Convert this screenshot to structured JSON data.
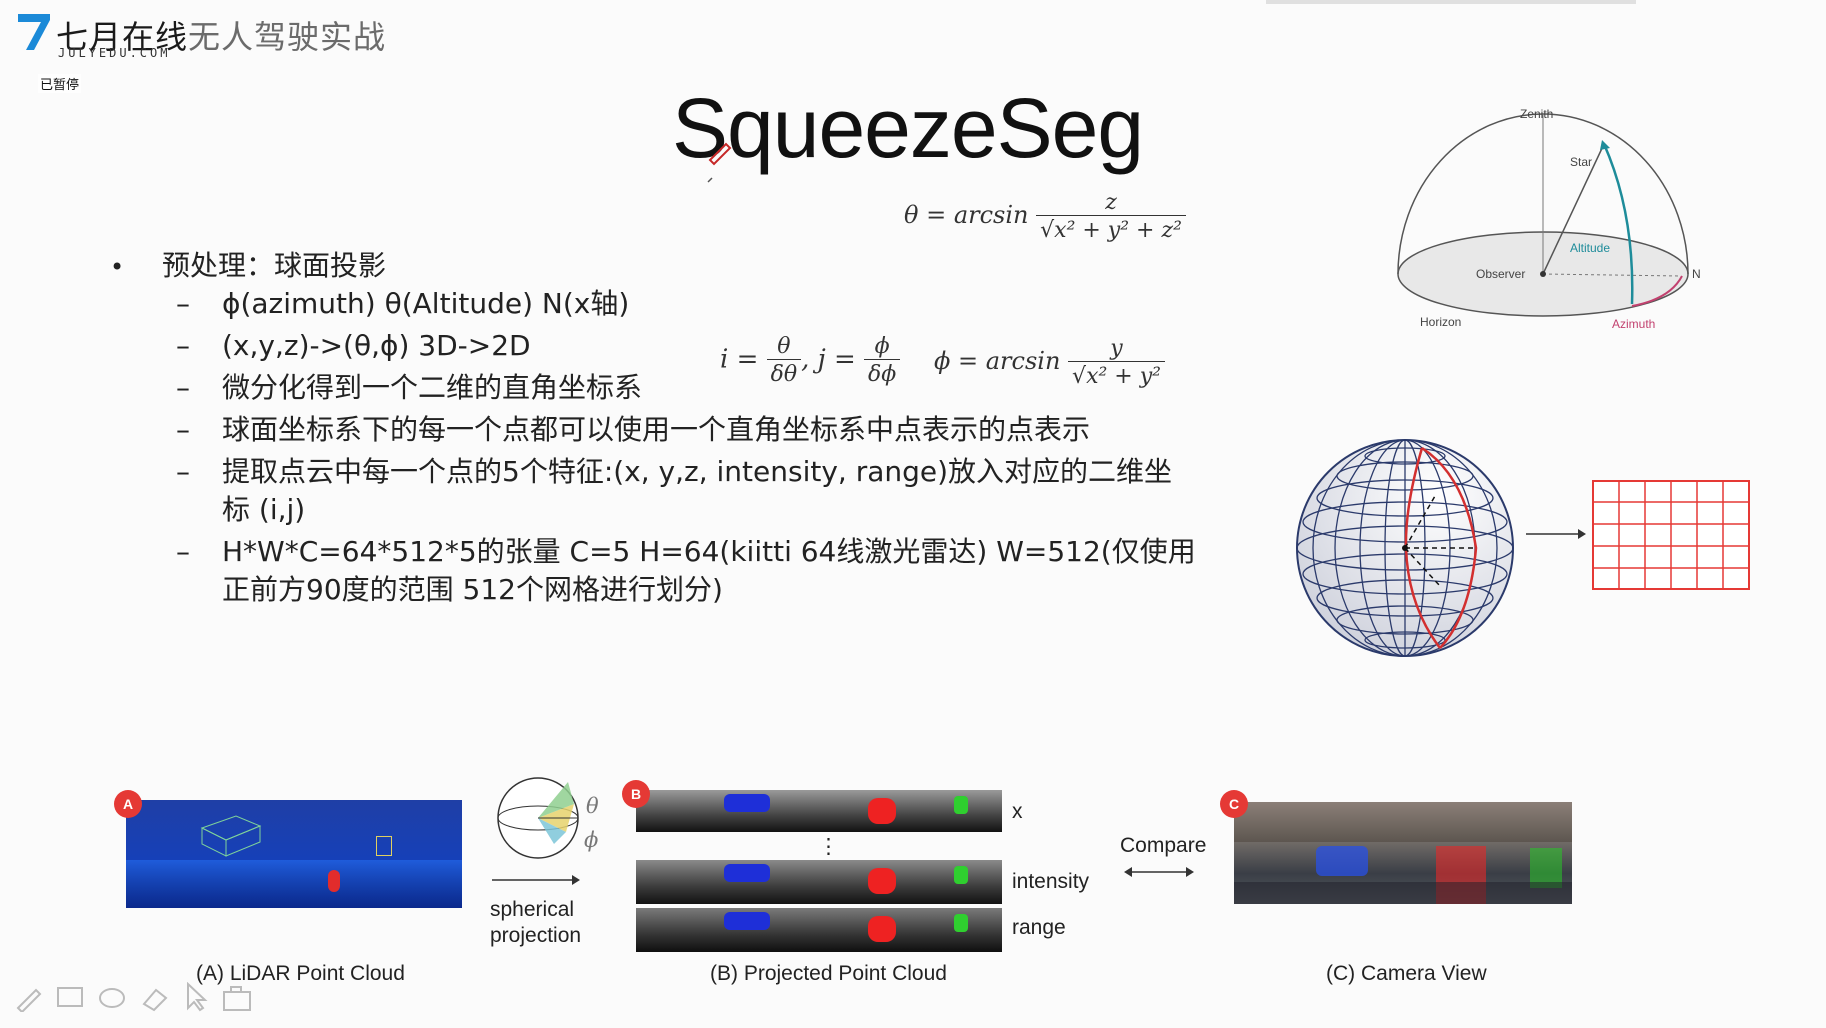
{
  "brand": {
    "name_part1": "七月在线",
    "name_part2": "无人驾驶实战",
    "url": "JULYEDU.COM",
    "status": "已暂停"
  },
  "slide": {
    "title": "SqueezeSeg",
    "bullet_main": "预处理：球面投影",
    "sub_items": [
      "ϕ(azimuth) θ(Altitude) N(x轴)",
      "(x,y,z)->(θ,ϕ)  3D->2D",
      "微分化得到一个二维的直角坐标系",
      "球面坐标系下的每一个点都可以使用一个直角坐标系中点表示的点表示",
      "提取点云中每一个点的5个特征:(x, y,z, intensity, range)放入对应的二维坐",
      "标 (i,j)",
      "H*W*C=64*512*5的张量 C=5 H=64(kiitti 64线激光雷达) W=512(仅使用",
      "正前方90度的范围 512个网格进行划分)"
    ],
    "formulas": {
      "theta_lhs": "θ = arcsin",
      "theta_num": "z",
      "theta_den": "√x² + y² + z²",
      "i_lhs": "i =",
      "i_num": "θ",
      "i_den": "δθ",
      "j_lhs": ", j =",
      "j_num": "ϕ",
      "j_den": "δϕ",
      "phi_lhs": "ϕ = arcsin",
      "phi_num": "y",
      "phi_den": "√x² + y²"
    },
    "hemisphere": {
      "zenith": "Zenith",
      "star": "Star",
      "altitude": "Altitude",
      "observer": "Observer",
      "n": "N",
      "horizon": "Horizon",
      "azimuth": "Azimuth"
    },
    "bottom": {
      "badge_a": "A",
      "badge_b": "B",
      "badge_c": "C",
      "label_a": "(A) LiDAR Point Cloud",
      "label_b": "(B) Projected Point Cloud",
      "label_c": "(C) Camera View",
      "theta_sym": "θ",
      "phi_sym": "ϕ",
      "spherical": "spherical",
      "projection": "projection",
      "x_label": "x",
      "ellipsis": "⋮",
      "intensity_label": "intensity",
      "range_label": "range",
      "compare": "Compare"
    }
  },
  "colors": {
    "accent_red": "#e53935",
    "teal": "#1e8c9a",
    "pink": "#c2416f",
    "grid_blue": "#2b3a6b",
    "brand_blue": "#1b8ad8"
  },
  "toolbar_icons": [
    "pen-icon",
    "screen-icon",
    "shape-icon",
    "eraser-icon",
    "pointer-icon",
    "camera-icon"
  ]
}
